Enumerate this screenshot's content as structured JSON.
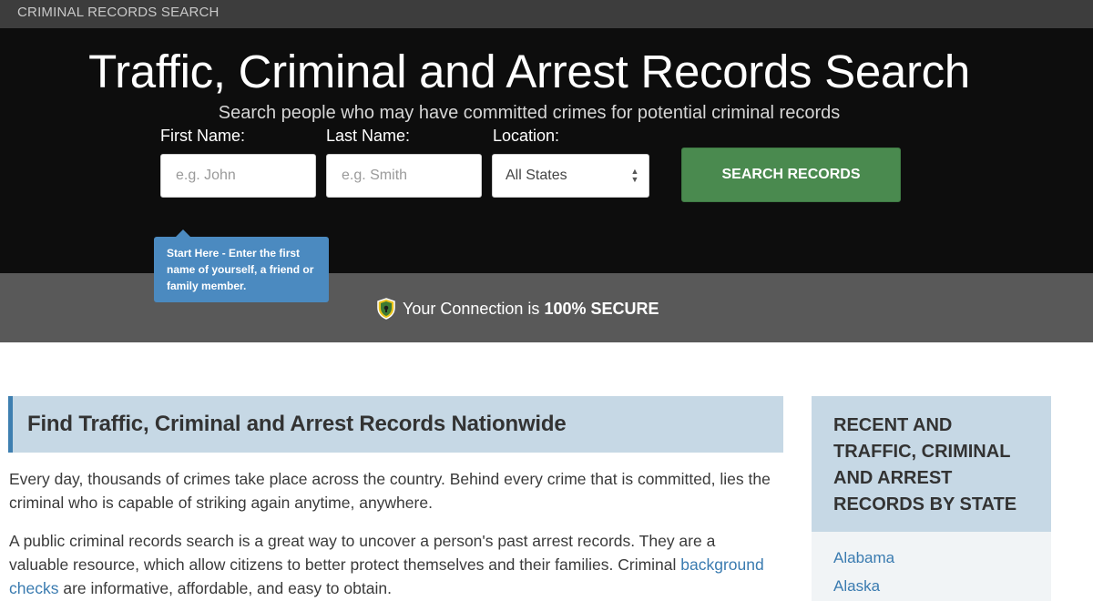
{
  "topbar": {
    "brand": "CRIMINAL RECORDS SEARCH"
  },
  "hero": {
    "title": "Traffic, Criminal and Arrest Records Search",
    "subtitle": "Search people who may have committed crimes for potential criminal records"
  },
  "form": {
    "first_name_label": "First Name:",
    "first_name_placeholder": "e.g. John",
    "last_name_label": "Last Name:",
    "last_name_placeholder": "e.g. Smith",
    "location_label": "Location:",
    "location_value": "All States",
    "search_label": "SEARCH RECORDS"
  },
  "tooltip": {
    "text": "Start Here - Enter the first name of yourself, a friend or family member."
  },
  "secure": {
    "prefix": "Your Connection is",
    "bold": "100% SECURE"
  },
  "main": {
    "heading": "Find Traffic, Criminal and Arrest Records Nationwide",
    "para1": "Every day, thousands of crimes take place across the country. Behind every crime that is committed, lies the criminal who is capable of striking again anytime, anywhere.",
    "para2_before": "A public criminal records search is a great way to uncover a person's past arrest records. They are a valuable resource, which allow citizens to better protect themselves and their families. Criminal",
    "para2_link": "background checks",
    "para2_after": "are informative, affordable, and easy to obtain."
  },
  "sidebar": {
    "heading": "RECENT AND TRAFFIC, CRIMINAL AND ARREST RECORDS BY STATE",
    "links": [
      "Alabama",
      "Alaska"
    ]
  },
  "colors": {
    "search_button": "#4a8a4f",
    "tooltip": "#4b8ac0",
    "panel": "#c6d8e5",
    "link": "#3a7bb0",
    "shield": "#e8c21a"
  },
  "icons": {
    "secure": "shield-lock-icon",
    "select": "updown-arrows-icon"
  }
}
